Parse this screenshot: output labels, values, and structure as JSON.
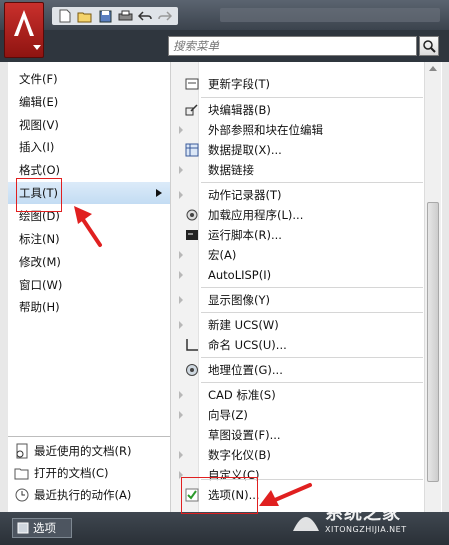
{
  "search": {
    "placeholder": "搜索菜单"
  },
  "left_menu": {
    "items": [
      {
        "label": "文件(F)"
      },
      {
        "label": "编辑(E)"
      },
      {
        "label": "视图(V)"
      },
      {
        "label": "插入(I)"
      },
      {
        "label": "格式(O)"
      },
      {
        "label": "工具(T)",
        "active": true
      },
      {
        "label": "绘图(D)"
      },
      {
        "label": "标注(N)"
      },
      {
        "label": "修改(M)"
      },
      {
        "label": "窗口(W)"
      },
      {
        "label": "帮助(H)"
      }
    ]
  },
  "right_menu": {
    "items": [
      {
        "label": "更新字段(T)",
        "icon": "field-update-icon"
      },
      {
        "label": "块编辑器(B)",
        "icon": "block-editor-icon"
      },
      {
        "label": "外部参照和块在位编辑",
        "submenu": true
      },
      {
        "label": "数据提取(X)...",
        "icon": "data-extract-icon"
      },
      {
        "label": "数据链接",
        "submenu": true
      },
      {
        "label": "动作记录器(T)",
        "submenu": true
      },
      {
        "label": "加载应用程序(L)...",
        "icon": "load-app-icon"
      },
      {
        "label": "运行脚本(R)...",
        "icon": "script-icon"
      },
      {
        "label": "宏(A)",
        "submenu": true
      },
      {
        "label": "AutoLISP(I)",
        "submenu": true
      },
      {
        "label": "显示图像(Y)",
        "submenu": true
      },
      {
        "label": "新建 UCS(W)",
        "submenu": true
      },
      {
        "label": "命名 UCS(U)...",
        "icon": "named-ucs-icon"
      },
      {
        "label": "地理位置(G)...",
        "icon": "geolocation-icon"
      },
      {
        "label": "CAD 标准(S)",
        "submenu": true
      },
      {
        "label": "向导(Z)",
        "submenu": true
      },
      {
        "label": "草图设置(F)..."
      },
      {
        "label": "数字化仪(B)",
        "submenu": true
      },
      {
        "label": "自定义(C)",
        "submenu": true
      },
      {
        "label": "选项(N)...",
        "icon": "options-check-icon"
      }
    ]
  },
  "recent": {
    "items": [
      {
        "label": "最近使用的文档(R)",
        "icon": "recent-docs-icon"
      },
      {
        "label": "打开的文档(C)",
        "icon": "open-docs-icon"
      },
      {
        "label": "最近执行的动作(A)",
        "icon": "recent-actions-icon"
      }
    ]
  },
  "bottom": {
    "options_label": "选项"
  },
  "watermark": {
    "main": "系统之家",
    "sub": "XITONGZHIJIA.NET"
  },
  "colors": {
    "accent_red": "#e02020",
    "highlight": "#c3dcf3"
  }
}
